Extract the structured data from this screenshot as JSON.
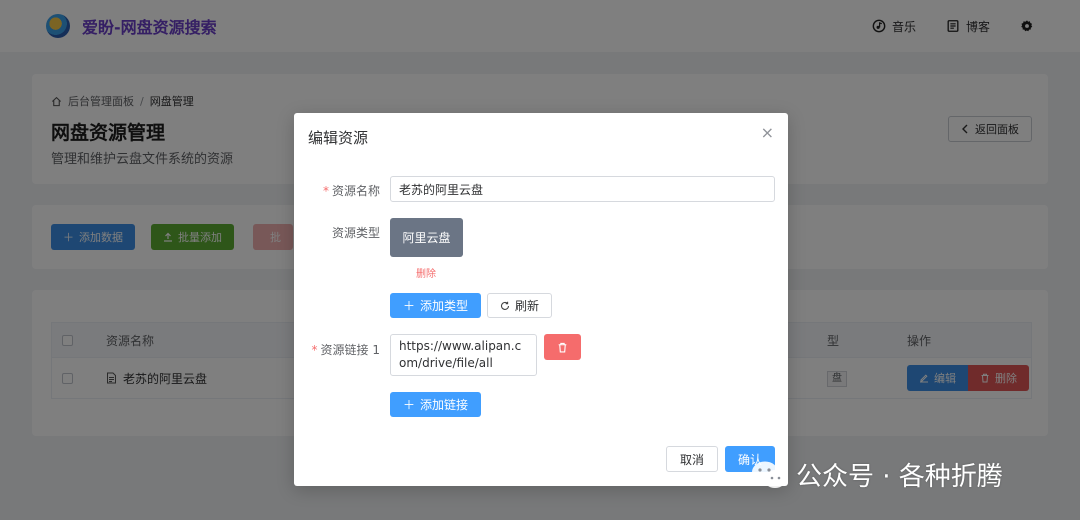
{
  "header": {
    "brand": "爱盼-网盘资源搜索",
    "music_label": "音乐",
    "blog_label": "博客"
  },
  "page": {
    "breadcrumb_home": "后台管理面板",
    "breadcrumb_sep": "/",
    "breadcrumb_current": "网盘管理",
    "title": "网盘资源管理",
    "subtitle": "管理和维护云盘文件系统的资源",
    "back_label": "返回面板",
    "add_data_label": "添加数据",
    "batch_add_label": "批量添加",
    "batch_del_label": "批"
  },
  "table": {
    "col_name": "资源名称",
    "col_type": "型",
    "col_ops": "操作",
    "rows": [
      {
        "name": "老苏的阿里云盘",
        "type_tag": "盘"
      }
    ],
    "edit_label": "编辑",
    "delete_label": "删除"
  },
  "modal": {
    "title": "编辑资源",
    "close": "×",
    "name_label": "资源名称",
    "name_value": "老苏的阿里云盘",
    "type_label": "资源类型",
    "type_tile": "阿里云盘",
    "type_delete": "删除",
    "add_type_label": "添加类型",
    "refresh_label": "刷新",
    "link_label": "资源链接 1",
    "link_value": "https://www.alipan.com/drive/file/all",
    "add_link_label": "添加链接",
    "cancel_label": "取消",
    "confirm_label": "确认"
  },
  "watermark": {
    "text": "公众号 · 各种折腾"
  },
  "colors": {
    "primary": "#409eff",
    "danger": "#f56c6c",
    "success": "#5cac32",
    "brand": "#6a3fc8"
  },
  "icons": [
    "home-icon",
    "music-icon",
    "blog-icon",
    "gear-icon",
    "chevron-left-icon",
    "plus-icon",
    "upload-icon",
    "refresh-icon",
    "trash-icon",
    "edit-icon",
    "file-icon",
    "close-icon",
    "wechat-icon"
  ]
}
